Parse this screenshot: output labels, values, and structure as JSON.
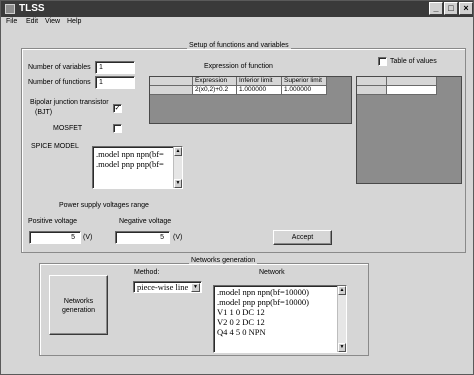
{
  "window": {
    "title": "TLSS",
    "minimize_glyph": "_",
    "maximize_glyph": "□",
    "close_glyph": "×"
  },
  "menu": [
    "File",
    "Edit",
    "View",
    "Help"
  ],
  "setup": {
    "group_label": "Setup of functions and variables",
    "num_variables_label": "Number of variables",
    "num_variables_value": "1",
    "num_functions_label": "Number of functions",
    "num_functions_value": "1",
    "bjt_label_line1": "Bipolar junction transistor",
    "bjt_label_line2": "(BJT)",
    "bjt_checked": true,
    "mosfet_label": "MOSFET",
    "mosfet_checked": false,
    "check_glyph": "✓",
    "spice_label": "SPICE MODEL",
    "spice_lines": [
      ".model npn npn(bf=",
      ".model pnp pnp(bf="
    ],
    "expression_title": "Expression of function",
    "table_headers": [
      "Expression",
      "Inferior limit",
      "Superior limit"
    ],
    "table_row": [
      "2(x0,2)+0.2",
      "1.000000",
      "1.000000"
    ],
    "table_of_values_label": "Table of values",
    "table_of_values_checked": false,
    "power_title": "Power supply voltages range",
    "positive_label": "Positive voltage",
    "positive_value": "5",
    "positive_unit": "(V)",
    "negative_label": "Negative voltage",
    "negative_value": "5",
    "negative_unit": "(V)",
    "accept_label": "Accept"
  },
  "networks": {
    "group_label": "Networks generation",
    "generate_button_line1": "Networks",
    "generate_button_line2": "generation",
    "method_label": "Method:",
    "method_selected": "piece-wise line",
    "network_label": "Network",
    "network_lines": [
      ".model npn npn(bf=10000)",
      ".model pnp pnp(bf=10000)",
      "V1 1 0 DC 12",
      "V2 0 2 DC 12",
      "Q4 4 5 0 NPN"
    ]
  },
  "colors": {
    "window_bg": "#d6d6d6",
    "titlebar": "#3a3a3a",
    "grid_bg": "#8c8c8c"
  }
}
